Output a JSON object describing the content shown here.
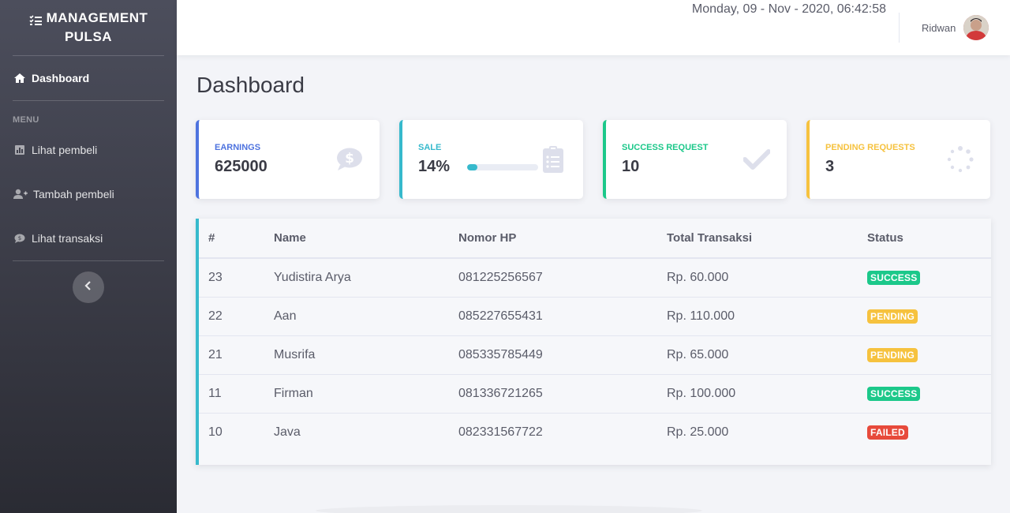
{
  "brand": {
    "line1": "MANAGEMENT",
    "line2": "PULSA"
  },
  "sidebar": {
    "dashboard": "Dashboard",
    "section_label": "MENU",
    "items": [
      {
        "label": "Lihat pembeli",
        "icon": "chart-icon"
      },
      {
        "label": "Tambah pembeli",
        "icon": "user-plus-icon"
      },
      {
        "label": "Lihat transaksi",
        "icon": "comment-dollar-icon"
      }
    ]
  },
  "topbar": {
    "datetime": "Monday, 09 - Nov - 2020, 06:42:58",
    "user_name": "Ridwan"
  },
  "page": {
    "title": "Dashboard"
  },
  "cards": {
    "earnings": {
      "label": "EARNINGS",
      "value": "625000",
      "color": "#4e73df"
    },
    "sale": {
      "label": "SALE",
      "value": "14%",
      "progress": 14,
      "color": "#36b9cc"
    },
    "success": {
      "label": "SUCCESS REQUEST",
      "value": "10",
      "color": "#1cc88a"
    },
    "pending": {
      "label": "PENDING REQUESTS",
      "value": "3",
      "color": "#f6c23e"
    }
  },
  "table": {
    "headers": [
      "#",
      "Name",
      "Nomor HP",
      "Total Transaksi",
      "Status"
    ],
    "rows": [
      {
        "id": "23",
        "name": "Yudistira Arya",
        "phone": "081225256567",
        "total": "Rp. 60.000",
        "status": "SUCCESS"
      },
      {
        "id": "22",
        "name": "Aan",
        "phone": "085227655431",
        "total": "Rp. 110.000",
        "status": "PENDING"
      },
      {
        "id": "21",
        "name": "Musrifa",
        "phone": "085335785449",
        "total": "Rp. 65.000",
        "status": "PENDING"
      },
      {
        "id": "11",
        "name": "Firman",
        "phone": "081336721265",
        "total": "Rp. 100.000",
        "status": "SUCCESS"
      },
      {
        "id": "10",
        "name": "Java",
        "phone": "082331567722",
        "total": "Rp. 25.000",
        "status": "FAILED"
      }
    ]
  }
}
